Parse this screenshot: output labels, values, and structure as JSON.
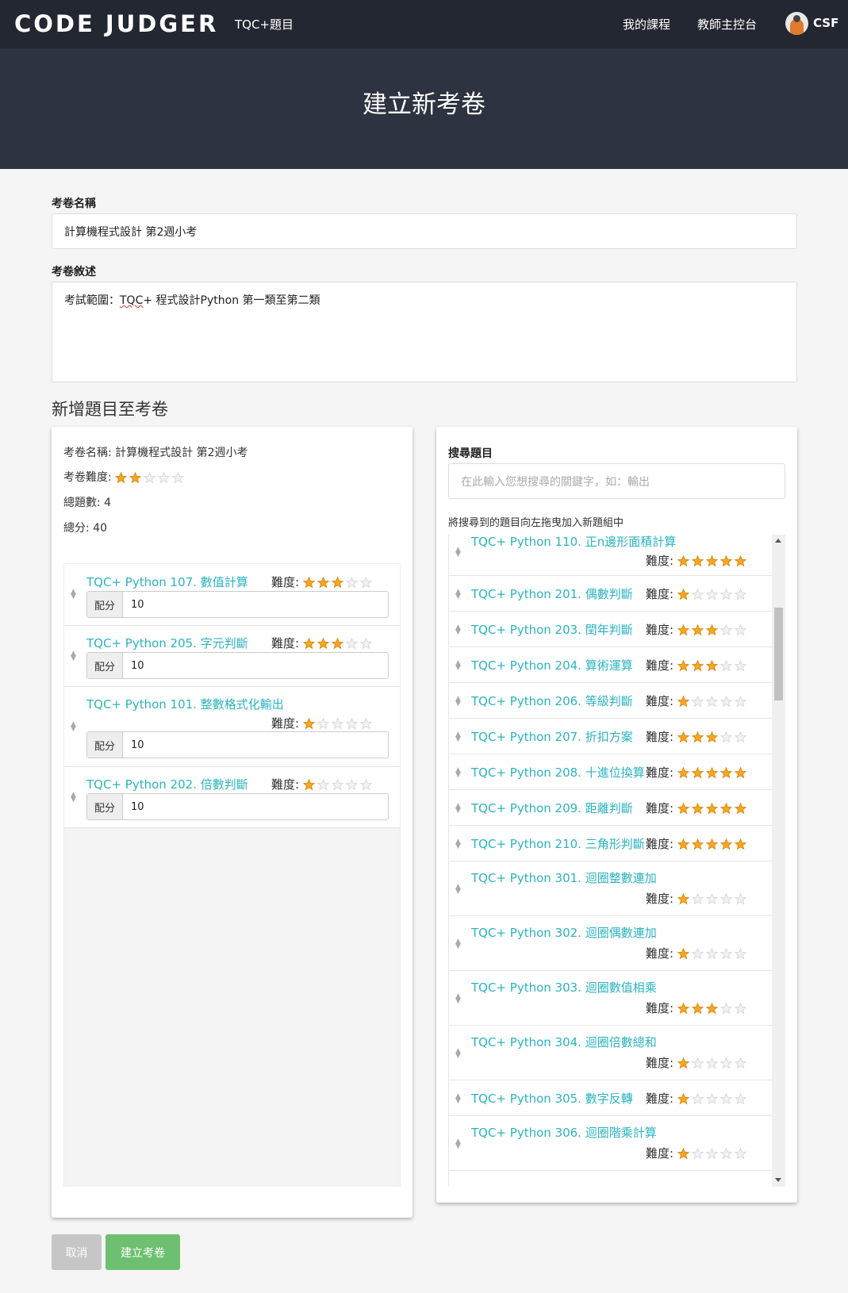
{
  "navbar": {
    "brand": "CODE JUDGER",
    "current_section": "TQC+題目",
    "my_courses": "我的課程",
    "teacher_console": "教師主控台",
    "user": "CSF"
  },
  "hero": {
    "title": "建立新考卷"
  },
  "form": {
    "name_label": "考卷名稱",
    "name_value": "計算機程式設計 第2週小考",
    "desc_label": "考卷敘述",
    "desc_prefix": "考試範圍：",
    "desc_marked": "TQC",
    "desc_suffix": "+ 程式設計Python  第一類至第二類"
  },
  "add_section_title": "新增題目至考卷",
  "summary": {
    "name_label": "考卷名稱:",
    "name_value": "計算機程式設計 第2週小考",
    "difficulty_label": "考卷難度:",
    "difficulty": 2,
    "count_label": "總題數:",
    "count_value": "4",
    "score_label": "總分:",
    "score_value": "40"
  },
  "difficulty_label": "難度:",
  "score_addon": "配分",
  "exam_items": [
    {
      "title": "TQC+ Python 107. 數值計算",
      "stars": 3,
      "score": "10"
    },
    {
      "title": "TQC+ Python 205. 字元判斷",
      "stars": 3,
      "score": "10"
    },
    {
      "title": "TQC+ Python 101. 整數格式化輸出",
      "stars": 1,
      "score": "10"
    },
    {
      "title": "TQC+ Python 202. 倍數判斷",
      "stars": 1,
      "score": "10"
    }
  ],
  "search": {
    "label": "搜尋題目",
    "placeholder": "在此輸入您想搜尋的關鍵字，如：輸出",
    "hint": "將搜尋到的題目向左拖曳加入新題組中"
  },
  "results": [
    {
      "title": "TQC+ Python 110. 正n邊形面積計算",
      "stars": 5
    },
    {
      "title": "TQC+ Python 201. 偶數判斷",
      "stars": 1
    },
    {
      "title": "TQC+ Python 203. 閏年判斷",
      "stars": 3
    },
    {
      "title": "TQC+ Python 204. 算術運算",
      "stars": 3
    },
    {
      "title": "TQC+ Python 206. 等級判斷",
      "stars": 1
    },
    {
      "title": "TQC+ Python 207. 折扣方案",
      "stars": 3
    },
    {
      "title": "TQC+ Python 208. 十進位換算",
      "stars": 5
    },
    {
      "title": "TQC+ Python 209. 距離判斷",
      "stars": 5
    },
    {
      "title": "TQC+ Python 210. 三角形判斷",
      "stars": 5
    },
    {
      "title": "TQC+ Python 301. 迴圈整數連加",
      "stars": 1
    },
    {
      "title": "TQC+ Python 302. 迴圈偶數連加",
      "stars": 1
    },
    {
      "title": "TQC+ Python 303. 迴圈數值相乘",
      "stars": 3
    },
    {
      "title": "TQC+ Python 304. 迴圈倍數總和",
      "stars": 1
    },
    {
      "title": "TQC+ Python 305. 數字反轉",
      "stars": 1
    },
    {
      "title": "TQC+ Python 306. 迴圈階乘計算",
      "stars": 1
    }
  ],
  "buttons": {
    "cancel": "取消",
    "create": "建立考卷"
  },
  "colors": {
    "star_on": "#f5a623",
    "star_off": "#d6d6d6",
    "link": "#2bb3c0",
    "create": "#6cc070"
  }
}
